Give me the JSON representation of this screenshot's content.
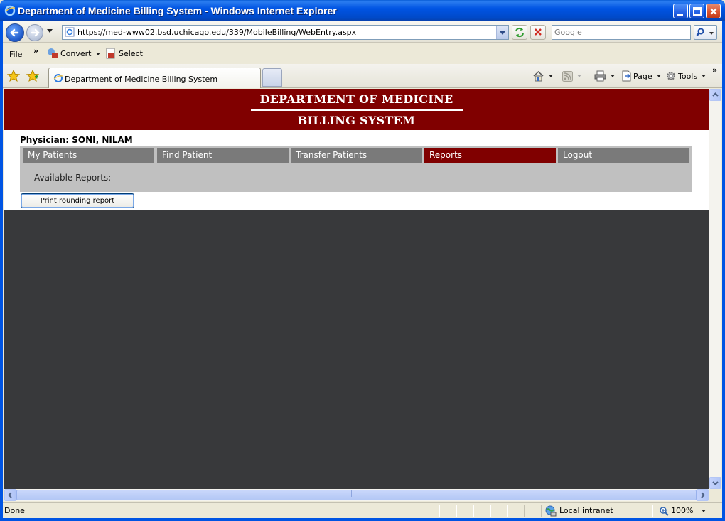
{
  "window": {
    "title": "Department of Medicine Billing System - Windows Internet Explorer"
  },
  "address_bar": {
    "url": "https://med-www02.bsd.uchicago.edu/339/MobileBilling/WebEntry.aspx"
  },
  "search": {
    "placeholder": "Google"
  },
  "menu": {
    "file_label": "File",
    "convert_label": "Convert",
    "select_label": "Select"
  },
  "tabs": {
    "active_label": "Department of Medicine Billing System"
  },
  "toolbar": {
    "page_label": "Page",
    "tools_label": "Tools"
  },
  "page": {
    "banner_line1": "DEPARTMENT OF MEDICINE",
    "banner_line2": "BILLING SYSTEM",
    "physician_label": "Physician: SONI, NILAM",
    "nav": [
      {
        "label": "My Patients",
        "active": false
      },
      {
        "label": "Find Patient",
        "active": false
      },
      {
        "label": "Transfer Patients",
        "active": false
      },
      {
        "label": "Reports",
        "active": true
      },
      {
        "label": "Logout",
        "active": false
      }
    ],
    "available_reports_label": "Available Reports:",
    "print_button_label": "Print rounding report"
  },
  "status": {
    "text": "Done",
    "zone": "Local intranet",
    "zoom": "100%"
  },
  "colors": {
    "banner": "#800000",
    "nav_inactive": "#7a7a7a",
    "nav_active": "#800000",
    "viewport_bg": "#38393b"
  }
}
